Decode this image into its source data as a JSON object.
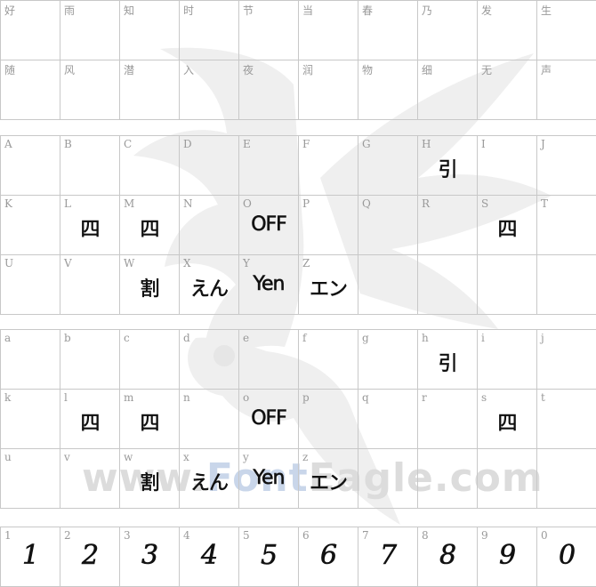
{
  "watermark": {
    "text_gray_1": "www.",
    "text_blue": "Font",
    "text_gray_2": "Eagle.com"
  },
  "rows": [
    [
      {
        "label": "好",
        "glyph": ""
      },
      {
        "label": "雨",
        "glyph": ""
      },
      {
        "label": "知",
        "glyph": ""
      },
      {
        "label": "时",
        "glyph": ""
      },
      {
        "label": "节",
        "glyph": ""
      },
      {
        "label": "当",
        "glyph": ""
      },
      {
        "label": "春",
        "glyph": ""
      },
      {
        "label": "乃",
        "glyph": ""
      },
      {
        "label": "发",
        "glyph": ""
      },
      {
        "label": "生",
        "glyph": ""
      }
    ],
    [
      {
        "label": "随",
        "glyph": ""
      },
      {
        "label": "风",
        "glyph": ""
      },
      {
        "label": "潜",
        "glyph": ""
      },
      {
        "label": "入",
        "glyph": ""
      },
      {
        "label": "夜",
        "glyph": ""
      },
      {
        "label": "润",
        "glyph": ""
      },
      {
        "label": "物",
        "glyph": ""
      },
      {
        "label": "细",
        "glyph": ""
      },
      {
        "label": "无",
        "glyph": ""
      },
      {
        "label": "声",
        "glyph": ""
      }
    ],
    [
      {
        "label": "A",
        "glyph": ""
      },
      {
        "label": "B",
        "glyph": ""
      },
      {
        "label": "C",
        "glyph": ""
      },
      {
        "label": "D",
        "glyph": ""
      },
      {
        "label": "E",
        "glyph": ""
      },
      {
        "label": "F",
        "glyph": ""
      },
      {
        "label": "G",
        "glyph": ""
      },
      {
        "label": "H",
        "glyph": "引"
      },
      {
        "label": "I",
        "glyph": ""
      },
      {
        "label": "J",
        "glyph": ""
      }
    ],
    [
      {
        "label": "K",
        "glyph": ""
      },
      {
        "label": "L",
        "glyph": "四"
      },
      {
        "label": "M",
        "glyph": "四"
      },
      {
        "label": "N",
        "glyph": ""
      },
      {
        "label": "O",
        "glyph": "OFF"
      },
      {
        "label": "P",
        "glyph": ""
      },
      {
        "label": "Q",
        "glyph": ""
      },
      {
        "label": "R",
        "glyph": ""
      },
      {
        "label": "S",
        "glyph": "四"
      },
      {
        "label": "T",
        "glyph": ""
      }
    ],
    [
      {
        "label": "U",
        "glyph": ""
      },
      {
        "label": "V",
        "glyph": ""
      },
      {
        "label": "W",
        "glyph": "割"
      },
      {
        "label": "X",
        "glyph": "えん"
      },
      {
        "label": "Y",
        "glyph": "Yen"
      },
      {
        "label": "Z",
        "glyph": "エン"
      },
      {
        "label": "",
        "glyph": ""
      },
      {
        "label": "",
        "glyph": ""
      },
      {
        "label": "",
        "glyph": ""
      },
      {
        "label": "",
        "glyph": ""
      }
    ],
    [
      {
        "label": "a",
        "glyph": ""
      },
      {
        "label": "b",
        "glyph": ""
      },
      {
        "label": "c",
        "glyph": ""
      },
      {
        "label": "d",
        "glyph": ""
      },
      {
        "label": "e",
        "glyph": ""
      },
      {
        "label": "f",
        "glyph": ""
      },
      {
        "label": "g",
        "glyph": ""
      },
      {
        "label": "h",
        "glyph": "引"
      },
      {
        "label": "i",
        "glyph": ""
      },
      {
        "label": "j",
        "glyph": ""
      }
    ],
    [
      {
        "label": "k",
        "glyph": ""
      },
      {
        "label": "l",
        "glyph": "四"
      },
      {
        "label": "m",
        "glyph": "四"
      },
      {
        "label": "n",
        "glyph": ""
      },
      {
        "label": "o",
        "glyph": "OFF"
      },
      {
        "label": "p",
        "glyph": ""
      },
      {
        "label": "q",
        "glyph": ""
      },
      {
        "label": "r",
        "glyph": ""
      },
      {
        "label": "s",
        "glyph": "四"
      },
      {
        "label": "t",
        "glyph": ""
      }
    ],
    [
      {
        "label": "u",
        "glyph": ""
      },
      {
        "label": "v",
        "glyph": ""
      },
      {
        "label": "w",
        "glyph": "割"
      },
      {
        "label": "x",
        "glyph": "えん"
      },
      {
        "label": "y",
        "glyph": "Yen"
      },
      {
        "label": "z",
        "glyph": "エン"
      },
      {
        "label": "",
        "glyph": ""
      },
      {
        "label": "",
        "glyph": ""
      },
      {
        "label": "",
        "glyph": ""
      },
      {
        "label": "",
        "glyph": ""
      }
    ],
    [
      {
        "label": "1",
        "glyph": "1"
      },
      {
        "label": "2",
        "glyph": "2"
      },
      {
        "label": "3",
        "glyph": "3"
      },
      {
        "label": "4",
        "glyph": "4"
      },
      {
        "label": "5",
        "glyph": "5"
      },
      {
        "label": "6",
        "glyph": "6"
      },
      {
        "label": "7",
        "glyph": "7"
      },
      {
        "label": "8",
        "glyph": "8"
      },
      {
        "label": "9",
        "glyph": "9"
      },
      {
        "label": "0",
        "glyph": "0"
      }
    ]
  ]
}
